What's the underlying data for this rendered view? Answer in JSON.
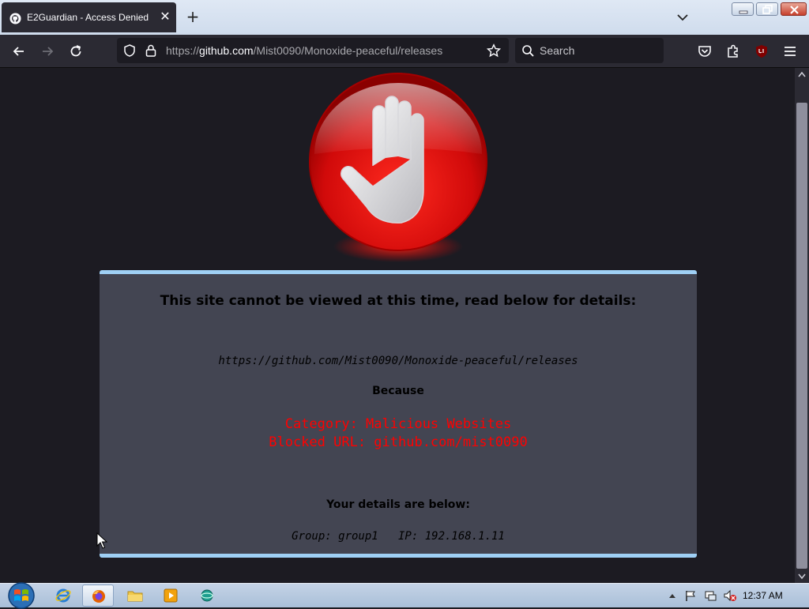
{
  "browser": {
    "tab_title": "E2Guardian - Access Denied",
    "url_prefix": "https://",
    "url_host": "github.com",
    "url_path": "/Mist0090/Monoxide-peaceful/releases",
    "search_placeholder": "Search"
  },
  "page": {
    "heading": "This site cannot be viewed at this time, read below for details:",
    "blocked_url": "https://github.com/Mist0090/Monoxide-peaceful/releases",
    "because_label": "Because",
    "category": "Category: Malicious Websites",
    "blocked_reason": "Blocked URL: github.com/mist0090",
    "details_title": "Your details are below:",
    "details": "Group: group1   IP: 192.168.1.11"
  },
  "taskbar": {
    "clock": "12:37 AM"
  },
  "colors": {
    "accent_border": "#9fd0f5",
    "alert_red": "#ff0000",
    "panel_bg": "#434552",
    "page_bg": "#1c1b22"
  }
}
